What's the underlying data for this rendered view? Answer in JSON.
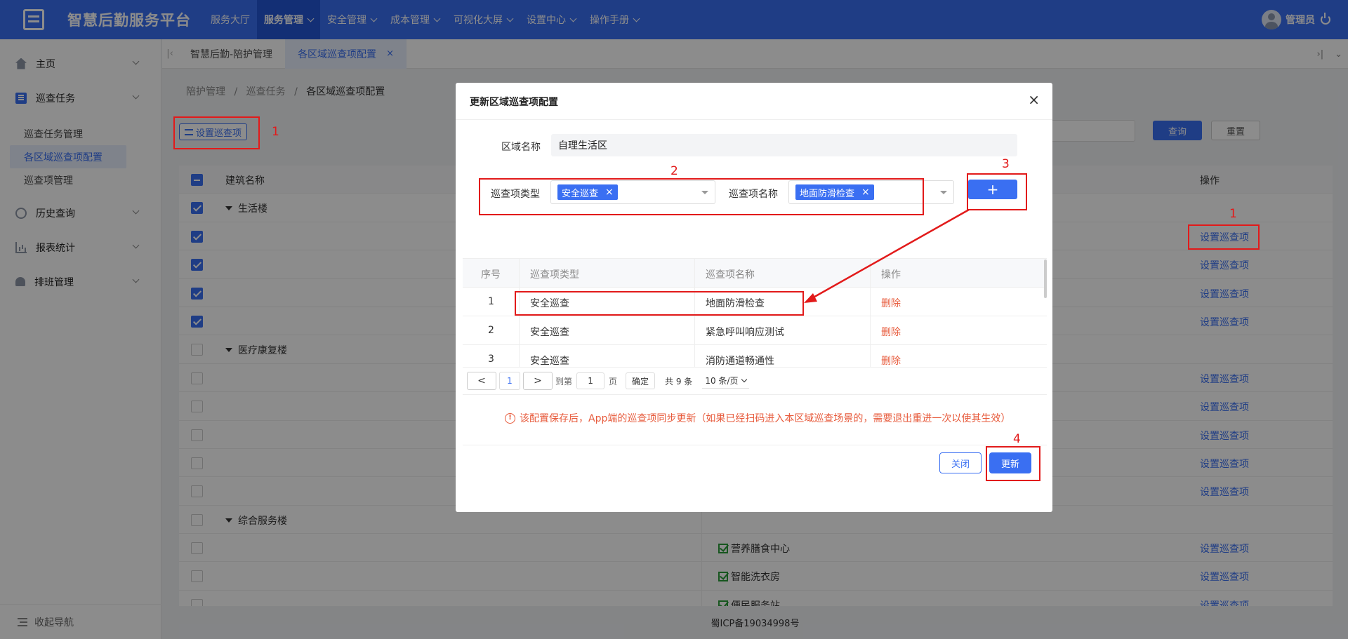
{
  "header": {
    "app_title": "智慧后勤服务平台",
    "nav": [
      {
        "label": "服务大厅",
        "has_menu": false
      },
      {
        "label": "服务管理",
        "has_menu": true,
        "active": true
      },
      {
        "label": "安全管理",
        "has_menu": true
      },
      {
        "label": "成本管理",
        "has_menu": true
      },
      {
        "label": "可视化大屏",
        "has_menu": true
      },
      {
        "label": "设置中心",
        "has_menu": true
      },
      {
        "label": "操作手册",
        "has_menu": true
      }
    ],
    "user_name": "管理员"
  },
  "sidebar": {
    "groups": [
      {
        "label": "主页",
        "icon": "home-icon"
      },
      {
        "label": "巡查任务",
        "icon": "task-icon"
      },
      {
        "label": "历史查询",
        "icon": "history-icon"
      },
      {
        "label": "报表统计",
        "icon": "report-icon"
      },
      {
        "label": "排班管理",
        "icon": "bell-icon"
      }
    ],
    "sub_items": [
      "巡查任务管理",
      "各区域巡查项配置",
      "巡查项管理"
    ],
    "collapse_label": "收起导航"
  },
  "tabs": [
    {
      "label": "智慧后勤-陪护管理"
    },
    {
      "label": "各区域巡查项配置",
      "active": true,
      "close": "×"
    }
  ],
  "breadcrumb": [
    "陪护管理",
    "巡查任务",
    "各区域巡查项配置"
  ],
  "toolbar": {
    "set_button": "设置巡查项",
    "query_button": "查询",
    "reset_button": "重置"
  },
  "table": {
    "headers": {
      "name": "建筑名称",
      "op": "操作"
    },
    "rows": [
      {
        "group": "生活楼",
        "checked": true
      },
      {
        "checked": true,
        "op": "设置巡查项"
      },
      {
        "checked": true,
        "op": "设置巡查项"
      },
      {
        "checked": true,
        "op": "设置巡查项"
      },
      {
        "checked": true,
        "op": "设置巡查项"
      },
      {
        "group": "医疗康复楼",
        "checked": false
      },
      {
        "checked": false,
        "op": "设置巡查项"
      },
      {
        "checked": false,
        "op": "设置巡查项"
      },
      {
        "checked": false,
        "op": "设置巡查项"
      },
      {
        "checked": false,
        "op": "设置巡查项"
      },
      {
        "checked": false,
        "op": "设置巡查项"
      },
      {
        "group": "综合服务楼",
        "checked": false
      },
      {
        "checked": false,
        "item": "营养膳食中心",
        "op": "设置巡查项"
      },
      {
        "checked": false,
        "item": "智能洗衣房",
        "op": "设置巡查项"
      },
      {
        "checked": false,
        "item": "便民服务站",
        "op": "设置巡查项"
      }
    ]
  },
  "modal": {
    "title": "更新区域巡查项配置",
    "close_icon": "×",
    "area_label": "区域名称",
    "area_value": "自理生活区",
    "type_label": "巡查项类型",
    "type_tag": "安全巡查",
    "name_label": "巡查项名称",
    "name_tag": "地面防滑检查",
    "tag_remove": "×",
    "add_button": "+",
    "columns": [
      "序号",
      "巡查项类型",
      "巡查项名称",
      "操作"
    ],
    "rows": [
      {
        "no": "1",
        "type": "安全巡查",
        "name": "地面防滑检查",
        "op": "删除"
      },
      {
        "no": "2",
        "type": "安全巡查",
        "name": "紧急呼叫响应测试",
        "op": "删除"
      },
      {
        "no": "3",
        "type": "安全巡查",
        "name": "消防通道畅通性",
        "op": "删除"
      }
    ],
    "pager": {
      "prev": "<",
      "next": ">",
      "current": "1",
      "goto_label": "到第",
      "goto_value": "1",
      "page_unit": "页",
      "confirm": "确定",
      "total": "共 9 条",
      "page_size": "10 条/页"
    },
    "warning": "该配置保存后，App端的巡查项同步更新（如果已经扫码进入本区域巡查场景的，需要退出重进一次以使其生效）",
    "close_button": "关闭",
    "update_button": "更新"
  },
  "annotations": [
    "1",
    "1",
    "2",
    "3",
    "4"
  ],
  "footer": "蜀ICP备19034998号",
  "colors": {
    "primary": "#3a6ff2",
    "danger": "#e75a3b",
    "annotation": "#e21a1a"
  }
}
